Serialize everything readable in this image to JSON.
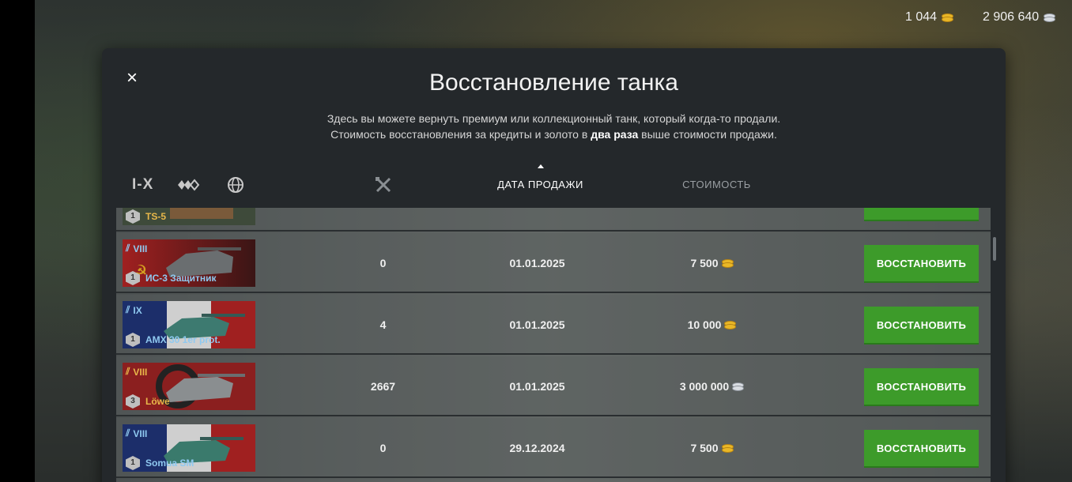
{
  "currencies": {
    "gold": "1 044",
    "silver": "2 906 640"
  },
  "dialog": {
    "title": "Восстановление танка",
    "close_icon": "×",
    "desc_line1": "Здесь вы можете вернуть премиум или коллекционный танк, который когда-то продали.",
    "desc_line2_pre": "Стоимость восстановления за кредиты и золото в",
    "desc_line2_bold": "два раза",
    "desc_line2_post": "выше стоимости продажи."
  },
  "filters": {
    "tier_label": "I-X",
    "type_icon": "vehicle-type-icon",
    "nation_icon": "globe-icon",
    "battles_icon": "crossed-swords-icon"
  },
  "columns": {
    "date": "ДАТА ПРОДАЖИ",
    "cost": "СТОИМОСТЬ"
  },
  "restore_label": "ВОССТАНОВИТЬ",
  "partial_row": {
    "name": "TS-5",
    "mastery": "1"
  },
  "rows": [
    {
      "tier": "VIII",
      "name": "ИС-3 Защитник",
      "mastery": "1",
      "battles": "0",
      "date": "01.01.2025",
      "cost": "7 500",
      "currency": "gold",
      "tier_color": "blue",
      "flag": "ussr"
    },
    {
      "tier": "IX",
      "name": "AMX 30 1er prot.",
      "mastery": "1",
      "battles": "4",
      "date": "01.01.2025",
      "cost": "10 000",
      "currency": "gold",
      "tier_color": "blue",
      "flag": "france"
    },
    {
      "tier": "VIII",
      "name": "Löwe",
      "mastery": "3",
      "battles": "2667",
      "date": "01.01.2025",
      "cost": "3 000 000",
      "currency": "silver",
      "tier_color": "gold",
      "flag": "germany"
    },
    {
      "tier": "VIII",
      "name": "Somua SM",
      "mastery": "1",
      "battles": "0",
      "date": "29.12.2024",
      "cost": "7 500",
      "currency": "gold",
      "tier_color": "blue",
      "flag": "france"
    }
  ]
}
